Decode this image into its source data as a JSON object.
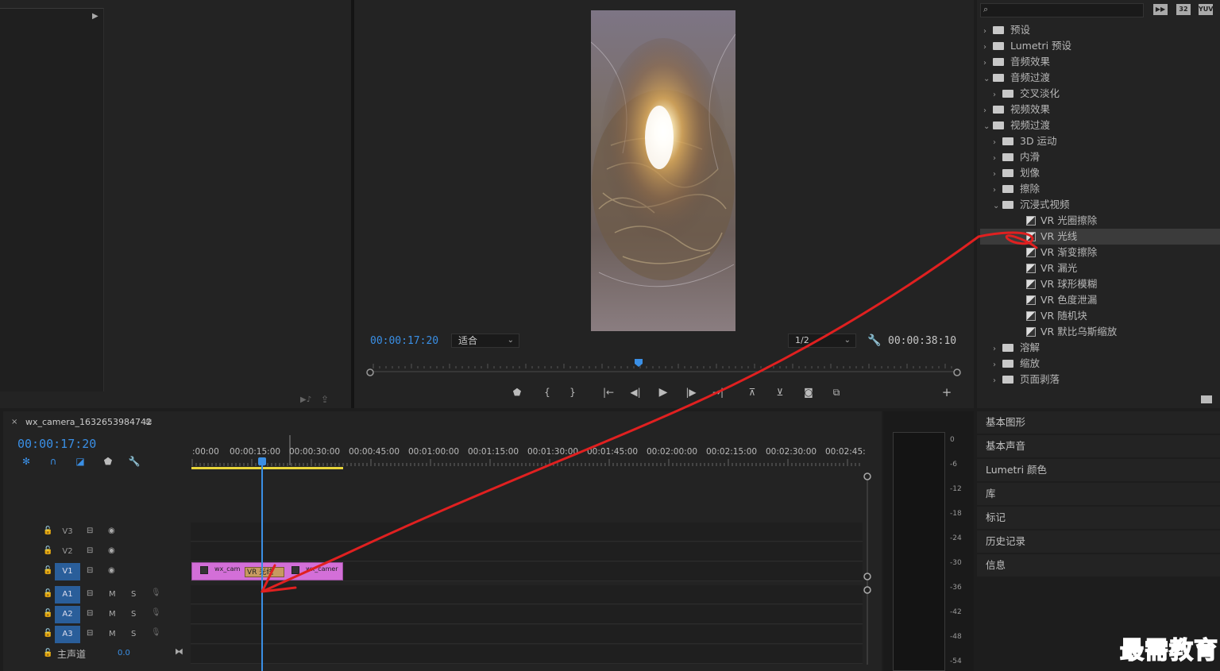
{
  "program_monitor": {
    "current_time": "00:00:17:20",
    "fit_label": "适合",
    "resolution_label": "1/2",
    "duration": "00:00:38:10"
  },
  "effects_panel": {
    "items": [
      {
        "label": "预设",
        "level": 0,
        "expanded": false,
        "type": "folder-star"
      },
      {
        "label": "Lumetri 预设",
        "level": 0,
        "expanded": false,
        "type": "folder-star"
      },
      {
        "label": "音频效果",
        "level": 0,
        "expanded": false,
        "type": "folder"
      },
      {
        "label": "音频过渡",
        "level": 0,
        "expanded": true,
        "type": "folder"
      },
      {
        "label": "交叉淡化",
        "level": 1,
        "expanded": false,
        "type": "folder"
      },
      {
        "label": "视频效果",
        "level": 0,
        "expanded": false,
        "type": "folder"
      },
      {
        "label": "视频过渡",
        "level": 0,
        "expanded": true,
        "type": "folder"
      },
      {
        "label": "3D 运动",
        "level": 1,
        "expanded": false,
        "type": "folder"
      },
      {
        "label": "内滑",
        "level": 1,
        "expanded": false,
        "type": "folder"
      },
      {
        "label": "划像",
        "level": 1,
        "expanded": false,
        "type": "folder"
      },
      {
        "label": "擦除",
        "level": 1,
        "expanded": false,
        "type": "folder"
      },
      {
        "label": "沉浸式视频",
        "level": 1,
        "expanded": true,
        "type": "folder"
      },
      {
        "label": "VR 光圈擦除",
        "level": 2,
        "type": "effect"
      },
      {
        "label": "VR 光线",
        "level": 2,
        "type": "effect",
        "selected": true
      },
      {
        "label": "VR 渐变擦除",
        "level": 2,
        "type": "effect"
      },
      {
        "label": "VR 漏光",
        "level": 2,
        "type": "effect"
      },
      {
        "label": "VR 球形模糊",
        "level": 2,
        "type": "effect"
      },
      {
        "label": "VR 色度泄漏",
        "level": 2,
        "type": "effect"
      },
      {
        "label": "VR 随机块",
        "level": 2,
        "type": "effect"
      },
      {
        "label": "VR 默比乌斯缩放",
        "level": 2,
        "type": "effect"
      },
      {
        "label": "溶解",
        "level": 1,
        "expanded": false,
        "type": "folder"
      },
      {
        "label": "缩放",
        "level": 1,
        "expanded": false,
        "type": "folder"
      },
      {
        "label": "页面剥落",
        "level": 1,
        "expanded": false,
        "type": "folder"
      }
    ],
    "toolbar_icons": [
      "accelerated-effects-icon",
      "32-bit-icon",
      "yuv-icon"
    ],
    "icon_text": {
      "b32": "32",
      "yuv": "YUV"
    }
  },
  "right_panels": [
    "基本图形",
    "基本声音",
    "Lumetri 颜色",
    "库",
    "标记",
    "历史记录",
    "信息"
  ],
  "timeline": {
    "sequence_name": "wx_camera_1632653984742",
    "current_time": "00:00:17:20",
    "ruler_labels": [
      ":00:00",
      "00:00:15:00",
      "00:00:30:00",
      "00:00:45:00",
      "00:01:00:00",
      "00:01:15:00",
      "00:01:30:00",
      "00:01:45:00",
      "00:02:00:00",
      "00:02:15:00",
      "00:02:30:00",
      "00:02:45:"
    ],
    "video_tracks": [
      "V3",
      "V2",
      "V1"
    ],
    "audio_tracks": [
      "A1",
      "A2",
      "A3"
    ],
    "audio_buttons": {
      "mute": "M",
      "solo": "S"
    },
    "master_label": "主声道",
    "master_value": "0.0",
    "clips": {
      "clip_a": "wx_cam",
      "transition": "VR 光线",
      "clip_b": "wx_camer"
    }
  },
  "audio_meter": {
    "db_labels": [
      "0",
      "-6",
      "-12",
      "-18",
      "-24",
      "-30",
      "-36",
      "-42",
      "-48",
      "-54"
    ]
  },
  "watermark": "最需教育",
  "accent_color": "#3a8fe5",
  "clip_color": "#d36fd8",
  "annotation_color": "#e02020"
}
